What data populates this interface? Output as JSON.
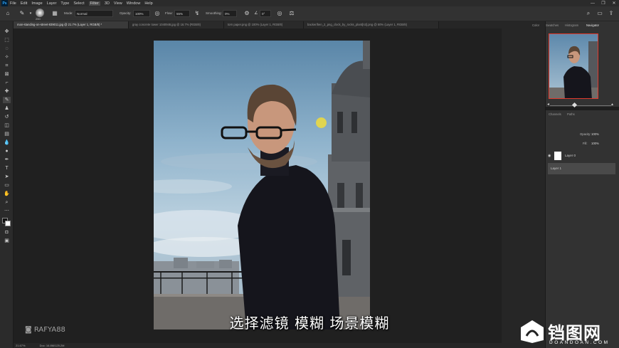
{
  "app": {
    "logo": "Ps"
  },
  "menu": [
    "File",
    "Edit",
    "Image",
    "Layer",
    "Type",
    "Select",
    "Filter",
    "3D",
    "View",
    "Window",
    "Help"
  ],
  "menu_active": "Filter",
  "window_controls": [
    "—",
    "❐",
    "✕"
  ],
  "options": {
    "brush_size": "250",
    "mode_label": "Mode:",
    "mode_value": "Normal",
    "opacity_label": "Opacity:",
    "opacity_value": "100%",
    "flow_label": "Flow:",
    "flow_value": "55%",
    "smoothing_label": "Smoothing:",
    "smoothing_value": "0%",
    "angle_value": "0°"
  },
  "tabs": [
    {
      "label": "man-standing-on-street-839011.jpg @ 21.7% (Layer 1, RGB/8) *",
      "active": true
    },
    {
      "label": "gray concrete tower 1040946.jpg @ 16.7% (RGB/8)",
      "active": false
    },
    {
      "label": "torn paper.png @ 100% (Layer 1, RGB/8)",
      "active": false
    },
    {
      "label": "backer/ben_2_png_clock_by_rocks_plant[n3].png @ 50% (Layer 1, RGB/8)",
      "active": false
    }
  ],
  "right_tabs": [
    "Color",
    "Swatches",
    "Histogram",
    "Navigator"
  ],
  "right_tab_active": "Navigator",
  "layers_tabs": [
    "Channels",
    "Paths"
  ],
  "layers": {
    "opacity_label": "Opacity:",
    "opacity_value": "100%",
    "fill_label": "Fill:",
    "fill_value": "100%",
    "items": [
      {
        "name": "Layer 0",
        "selected": false
      },
      {
        "name": "Layer 1",
        "selected": true
      }
    ]
  },
  "status": {
    "zoom": "21.67%",
    "doc": "Doc: 16.8M/125.2M"
  },
  "subtitle": "选择滤镜 模糊 场景模糊",
  "watermark": "RAFYA88",
  "brand": {
    "cn": "铛图网",
    "en": "DOANDOAN.COM"
  },
  "colors": {
    "accent": "#31a8ff",
    "nav_box": "#e03a2e",
    "cursor": "#f0dc3c"
  }
}
